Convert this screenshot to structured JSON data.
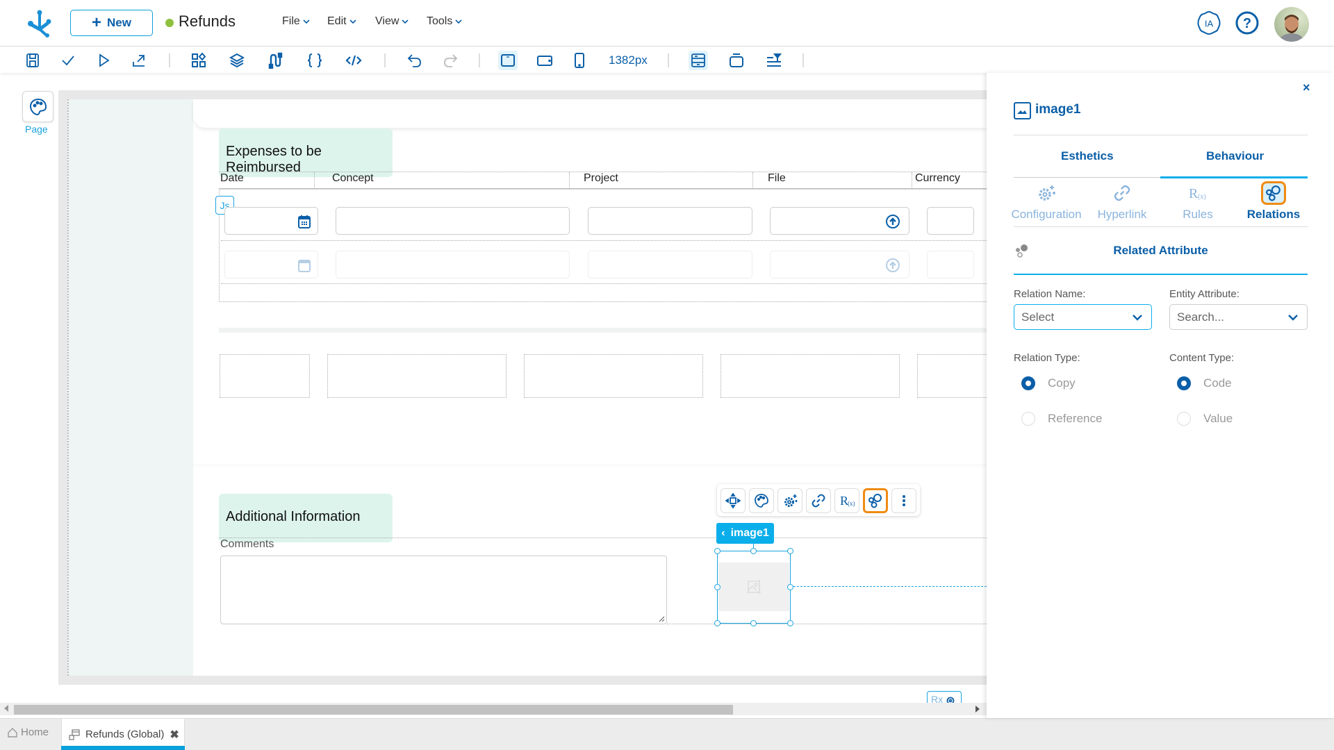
{
  "header": {
    "new_label": "New",
    "app_title": "Refunds",
    "status_color": "#8fc13e",
    "menus": [
      "File",
      "Edit",
      "View",
      "Tools"
    ],
    "ia_label": "IA",
    "help_label": "?"
  },
  "toolbar": {
    "width_readout": "1382px",
    "icons": [
      "save-icon",
      "check-icon",
      "play-icon",
      "export-icon",
      "components-icon",
      "layers-icon",
      "connector-icon",
      "braces-icon",
      "code-icon",
      "undo-icon",
      "redo-icon",
      "desktop-view-icon",
      "tablet-view-icon",
      "mobile-view-icon",
      "template-icon",
      "container-icon",
      "filter-align-icon"
    ]
  },
  "left_rail": {
    "page_label": "Page"
  },
  "canvas": {
    "section1_title": "Expenses to be Reimbursed",
    "columns": [
      "Date",
      "Concept",
      "Project",
      "File",
      "Currency"
    ],
    "js_badge": "Js",
    "section2_title": "Additional Information",
    "comments_label": "Comments",
    "selected_element": "image1",
    "rx_badge": "Rx"
  },
  "panel": {
    "title": "image1",
    "close_label": "×",
    "tabs": [
      "Esthetics",
      "Behaviour"
    ],
    "active_tab": "Behaviour",
    "subtabs": [
      "Configuration",
      "Hyperlink",
      "Rules",
      "Relations"
    ],
    "active_subtab": "Relations",
    "rules_glyph": "R(x)",
    "section_title": "Related Attribute",
    "relation_name_label": "Relation Name:",
    "relation_name_value": "Select",
    "entity_attribute_label": "Entity Attribute:",
    "entity_attribute_placeholder": "Search...",
    "relation_type_label": "Relation Type:",
    "relation_type_options": [
      "Copy",
      "Reference"
    ],
    "relation_type_selected": "Copy",
    "content_type_label": "Content Type:",
    "content_type_options": [
      "Code",
      "Value"
    ],
    "content_type_selected": "Code"
  },
  "bottom_tabs": {
    "home_label": "Home",
    "active_tab_label": "Refunds (Global)",
    "close_label": "✖"
  },
  "colors": {
    "brand": "#0b5fa8",
    "accent": "#0aaeea",
    "highlight": "#ef8b12",
    "section_bg": "#ddf4ed"
  }
}
